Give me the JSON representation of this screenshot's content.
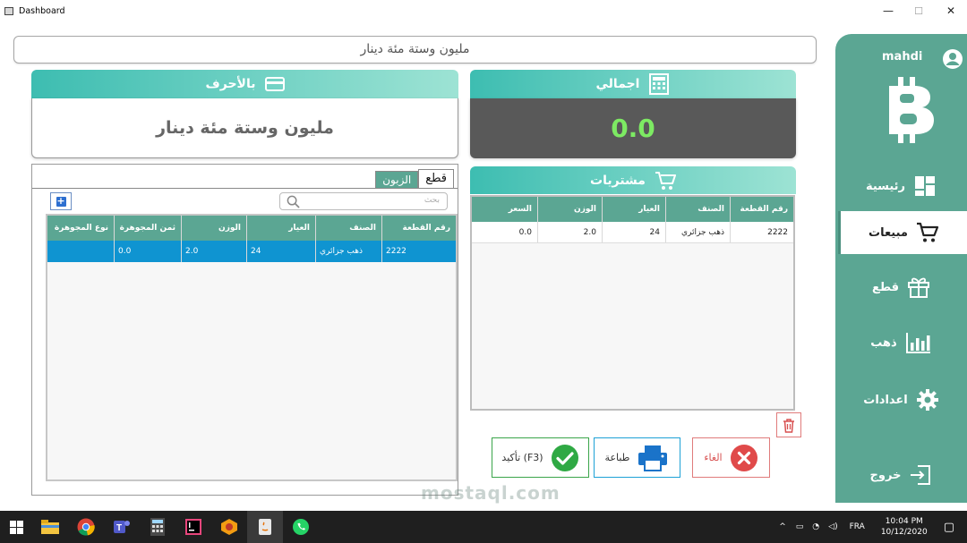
{
  "window": {
    "title": "Dashboard",
    "controls": {
      "minimize": "—",
      "maximize": "☐",
      "close": "✕"
    }
  },
  "top_field": {
    "value": "مليون وستة مئة دينار"
  },
  "watermark": "mostaql.com",
  "sidebar": {
    "username": "mahdi",
    "items": [
      {
        "label": "رئيسية",
        "icon": "dashboard-icon"
      },
      {
        "label": "مبيعات",
        "icon": "cart-icon",
        "active": true
      },
      {
        "label": "قطع",
        "icon": "gift-icon"
      },
      {
        "label": "ذهب",
        "icon": "bar-chart-icon"
      },
      {
        "label": "اعدادات",
        "icon": "gear-icon"
      },
      {
        "label": "خروج",
        "icon": "logout-icon"
      }
    ]
  },
  "words_card": {
    "title": "بالأحرف",
    "value": "مليون وستة مئة دينار"
  },
  "total_card": {
    "title": "اجمالي",
    "value": "0.0"
  },
  "purchases_card": {
    "title": "مشتريات"
  },
  "tabs": [
    {
      "label": "قطع",
      "active": true
    },
    {
      "label": "الزبون",
      "active": false
    }
  ],
  "search": {
    "placeholder": "بحث"
  },
  "left_table": {
    "columns": [
      "رقم القطعة",
      "الصنف",
      "العيار",
      "الوزن",
      "ثمن المجوهرة",
      "نوع المجوهرة"
    ],
    "rows": [
      [
        "2222",
        "ذهب جزائري",
        "24",
        "2.0",
        "0.0",
        ""
      ]
    ]
  },
  "right_table": {
    "columns": [
      "رقم القطعة",
      "الصنف",
      "العيار",
      "الوزن",
      "السعر"
    ],
    "rows": [
      [
        "2222",
        "ذهب جزائري",
        "24",
        "2.0",
        "0.0"
      ]
    ]
  },
  "buttons": {
    "cancel": "الغاء",
    "print": "طباعة",
    "confirm": "تأكيد (F3)"
  },
  "colors": {
    "accent": "#5ba693",
    "header_gradient_start": "#3dbdb1",
    "header_gradient_end": "#9de3d4",
    "total_bg": "#595959",
    "total_text": "#7dea63",
    "selected_row": "#0f94d1",
    "cancel_border": "#e07b7b",
    "print_border": "#1da1d6",
    "confirm_border": "#3aa54a"
  },
  "taskbar": {
    "language": "FRA",
    "time": "10:04 PM",
    "date": "10/12/2020",
    "apps": [
      "windows-start-icon",
      "search-icon",
      "file-explorer-icon",
      "chrome-icon",
      "teams-icon",
      "calculator-icon",
      "intellij-icon",
      "app-icon",
      "java-icon",
      "whatsapp-icon"
    ]
  }
}
